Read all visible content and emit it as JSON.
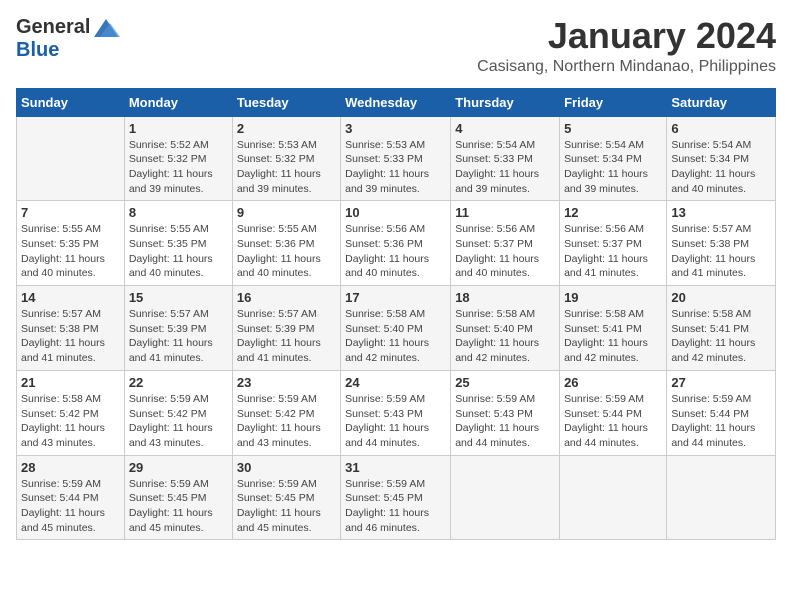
{
  "header": {
    "logo_general": "General",
    "logo_blue": "Blue",
    "month_title": "January 2024",
    "location": "Casisang, Northern Mindanao, Philippines"
  },
  "calendar": {
    "days_of_week": [
      "Sunday",
      "Monday",
      "Tuesday",
      "Wednesday",
      "Thursday",
      "Friday",
      "Saturday"
    ],
    "weeks": [
      [
        {
          "day": "",
          "info": ""
        },
        {
          "day": "1",
          "info": "Sunrise: 5:52 AM\nSunset: 5:32 PM\nDaylight: 11 hours\nand 39 minutes."
        },
        {
          "day": "2",
          "info": "Sunrise: 5:53 AM\nSunset: 5:32 PM\nDaylight: 11 hours\nand 39 minutes."
        },
        {
          "day": "3",
          "info": "Sunrise: 5:53 AM\nSunset: 5:33 PM\nDaylight: 11 hours\nand 39 minutes."
        },
        {
          "day": "4",
          "info": "Sunrise: 5:54 AM\nSunset: 5:33 PM\nDaylight: 11 hours\nand 39 minutes."
        },
        {
          "day": "5",
          "info": "Sunrise: 5:54 AM\nSunset: 5:34 PM\nDaylight: 11 hours\nand 39 minutes."
        },
        {
          "day": "6",
          "info": "Sunrise: 5:54 AM\nSunset: 5:34 PM\nDaylight: 11 hours\nand 40 minutes."
        }
      ],
      [
        {
          "day": "7",
          "info": "Sunrise: 5:55 AM\nSunset: 5:35 PM\nDaylight: 11 hours\nand 40 minutes."
        },
        {
          "day": "8",
          "info": "Sunrise: 5:55 AM\nSunset: 5:35 PM\nDaylight: 11 hours\nand 40 minutes."
        },
        {
          "day": "9",
          "info": "Sunrise: 5:55 AM\nSunset: 5:36 PM\nDaylight: 11 hours\nand 40 minutes."
        },
        {
          "day": "10",
          "info": "Sunrise: 5:56 AM\nSunset: 5:36 PM\nDaylight: 11 hours\nand 40 minutes."
        },
        {
          "day": "11",
          "info": "Sunrise: 5:56 AM\nSunset: 5:37 PM\nDaylight: 11 hours\nand 40 minutes."
        },
        {
          "day": "12",
          "info": "Sunrise: 5:56 AM\nSunset: 5:37 PM\nDaylight: 11 hours\nand 41 minutes."
        },
        {
          "day": "13",
          "info": "Sunrise: 5:57 AM\nSunset: 5:38 PM\nDaylight: 11 hours\nand 41 minutes."
        }
      ],
      [
        {
          "day": "14",
          "info": "Sunrise: 5:57 AM\nSunset: 5:38 PM\nDaylight: 11 hours\nand 41 minutes."
        },
        {
          "day": "15",
          "info": "Sunrise: 5:57 AM\nSunset: 5:39 PM\nDaylight: 11 hours\nand 41 minutes."
        },
        {
          "day": "16",
          "info": "Sunrise: 5:57 AM\nSunset: 5:39 PM\nDaylight: 11 hours\nand 41 minutes."
        },
        {
          "day": "17",
          "info": "Sunrise: 5:58 AM\nSunset: 5:40 PM\nDaylight: 11 hours\nand 42 minutes."
        },
        {
          "day": "18",
          "info": "Sunrise: 5:58 AM\nSunset: 5:40 PM\nDaylight: 11 hours\nand 42 minutes."
        },
        {
          "day": "19",
          "info": "Sunrise: 5:58 AM\nSunset: 5:41 PM\nDaylight: 11 hours\nand 42 minutes."
        },
        {
          "day": "20",
          "info": "Sunrise: 5:58 AM\nSunset: 5:41 PM\nDaylight: 11 hours\nand 42 minutes."
        }
      ],
      [
        {
          "day": "21",
          "info": "Sunrise: 5:58 AM\nSunset: 5:42 PM\nDaylight: 11 hours\nand 43 minutes."
        },
        {
          "day": "22",
          "info": "Sunrise: 5:59 AM\nSunset: 5:42 PM\nDaylight: 11 hours\nand 43 minutes."
        },
        {
          "day": "23",
          "info": "Sunrise: 5:59 AM\nSunset: 5:42 PM\nDaylight: 11 hours\nand 43 minutes."
        },
        {
          "day": "24",
          "info": "Sunrise: 5:59 AM\nSunset: 5:43 PM\nDaylight: 11 hours\nand 44 minutes."
        },
        {
          "day": "25",
          "info": "Sunrise: 5:59 AM\nSunset: 5:43 PM\nDaylight: 11 hours\nand 44 minutes."
        },
        {
          "day": "26",
          "info": "Sunrise: 5:59 AM\nSunset: 5:44 PM\nDaylight: 11 hours\nand 44 minutes."
        },
        {
          "day": "27",
          "info": "Sunrise: 5:59 AM\nSunset: 5:44 PM\nDaylight: 11 hours\nand 44 minutes."
        }
      ],
      [
        {
          "day": "28",
          "info": "Sunrise: 5:59 AM\nSunset: 5:44 PM\nDaylight: 11 hours\nand 45 minutes."
        },
        {
          "day": "29",
          "info": "Sunrise: 5:59 AM\nSunset: 5:45 PM\nDaylight: 11 hours\nand 45 minutes."
        },
        {
          "day": "30",
          "info": "Sunrise: 5:59 AM\nSunset: 5:45 PM\nDaylight: 11 hours\nand 45 minutes."
        },
        {
          "day": "31",
          "info": "Sunrise: 5:59 AM\nSunset: 5:45 PM\nDaylight: 11 hours\nand 46 minutes."
        },
        {
          "day": "",
          "info": ""
        },
        {
          "day": "",
          "info": ""
        },
        {
          "day": "",
          "info": ""
        }
      ]
    ]
  }
}
